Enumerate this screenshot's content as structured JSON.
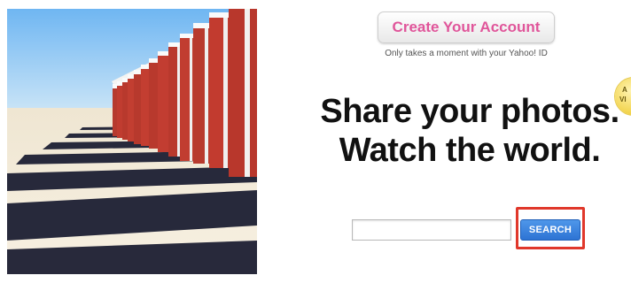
{
  "header": {
    "create_account_label": "Create Your Account",
    "create_account_subtext": "Only takes a moment with your Yahoo! ID"
  },
  "badge": {
    "line1": "A",
    "line2": "VI"
  },
  "hero": {
    "line1": "Share your photos.",
    "line2": "Watch the world."
  },
  "search": {
    "input_value": "",
    "button_label": "SEARCH"
  },
  "colors": {
    "create_account_text": "#e0559a",
    "search_button": "#2d73d4",
    "highlight_outline": "#e0382b"
  }
}
